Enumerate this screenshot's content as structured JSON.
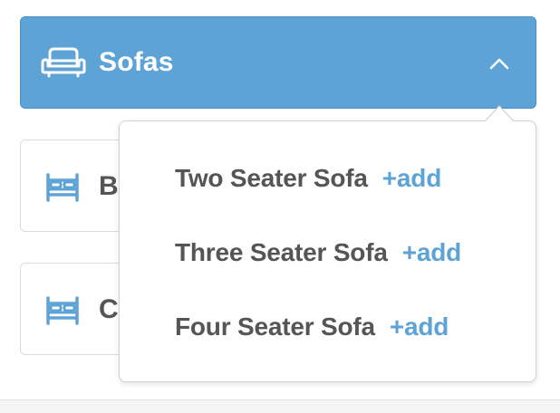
{
  "header": {
    "label": "Sofas",
    "icon": "sofa-icon",
    "chevron_icon": "chevron-up-icon",
    "background_color": "#5ea3d6"
  },
  "categories": [
    {
      "label": "Beds",
      "icon": "bed-icon"
    },
    {
      "label": "Chairs",
      "icon": "bed-icon"
    }
  ],
  "dropdown": {
    "options": [
      {
        "name": "Two Seater Sofa",
        "action": "+add"
      },
      {
        "name": "Three Seater Sofa",
        "action": "+add"
      },
      {
        "name": "Four Seater Sofa",
        "action": "+add"
      }
    ]
  },
  "colors": {
    "accent": "#5ea3d6",
    "text": "#555555",
    "icon": "#5ea3d6"
  }
}
